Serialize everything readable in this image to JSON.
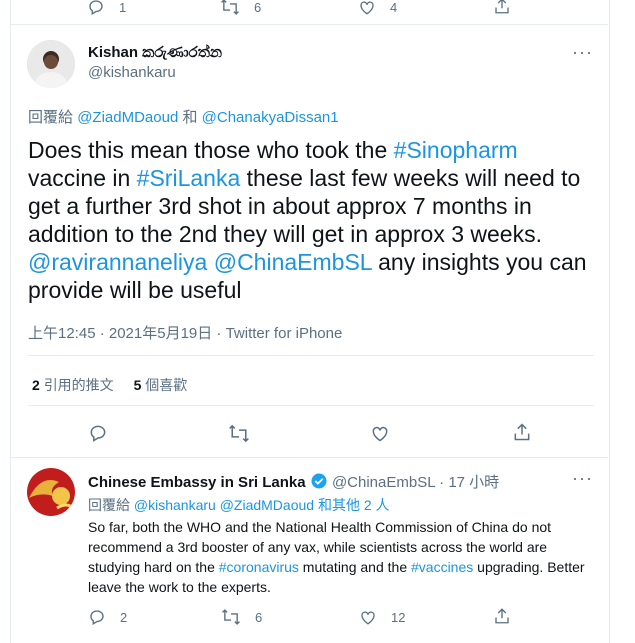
{
  "top_actions": {
    "reply_count": "1",
    "retweet_count": "6",
    "like_count": "4"
  },
  "main_tweet": {
    "author_name": "Kishan කරුණාරත්න",
    "author_handle": "@kishankaru",
    "reply_prefix": "回覆給",
    "reply_to_1": "@ZiadMDaoud",
    "reply_and": "和",
    "reply_to_2": "@ChanakyaDissan1",
    "text_1": "Does this mean those who took the ",
    "hashtag_1": "#Sinopharm",
    "text_2": " vaccine in ",
    "hashtag_2": "#SriLanka",
    "text_3": " these last few weeks will need to get a further 3rd shot in about approx 7 months in addition to the 2nd they will get in approx 3 weeks. ",
    "mention_1": "@ravirannaneliya",
    "text_4": " ",
    "mention_2": "@ChinaEmbSL",
    "text_5": " any insights you can provide will be useful",
    "timestamp": "上午12:45 · 2021年5月19日 · Twitter for iPhone",
    "quote_count": "2",
    "quote_label": "引用的推文",
    "like_count": "5",
    "like_label": "個喜歡"
  },
  "reply_tweet": {
    "author_name": "Chinese Embassy in Sri Lanka",
    "author_handle": "@ChinaEmbSL",
    "time": "· 17 小時",
    "reply_prefix": "回覆給",
    "reply_to_1": "@kishankaru",
    "reply_to_2": "@ZiadMDaoud",
    "reply_others": "和其他 2 人",
    "text_1": "So far, both the WHO and the National Health Commission of China do not recommend a 3rd booster of any vax, while scientists across the world are studying hard on the ",
    "hashtag_1": "#coronavirus",
    "text_2": " mutating and the ",
    "hashtag_2": "#vaccines",
    "text_3": " upgrading. Better leave the work to the experts.",
    "reply_count": "2",
    "retweet_count": "6",
    "like_count": "12"
  },
  "colors": {
    "link": "#1b95e0",
    "muted": "#5b7083",
    "verified": "#1da1f2"
  }
}
